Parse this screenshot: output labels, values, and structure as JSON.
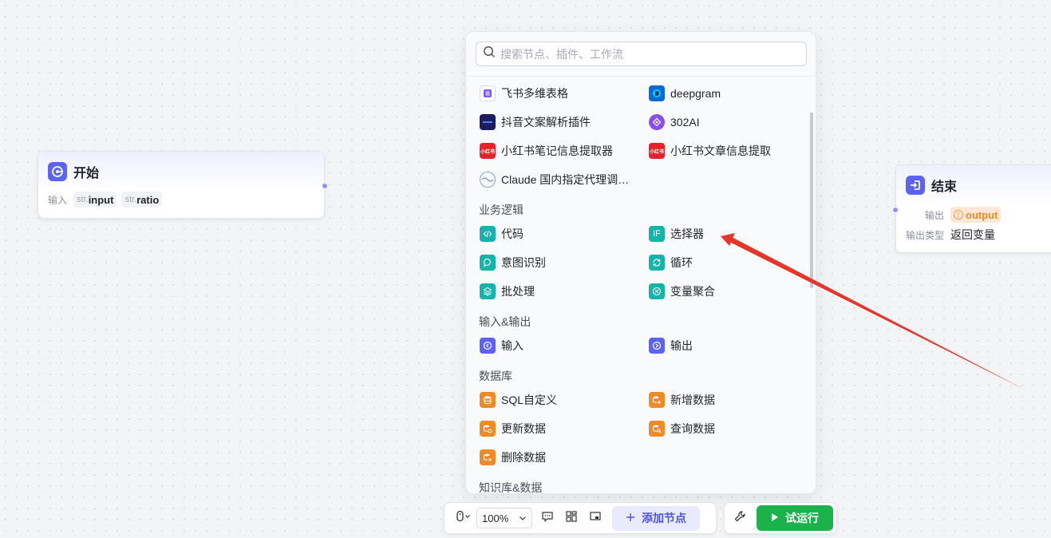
{
  "start_node": {
    "title": "开始",
    "input_label": "输入",
    "params": [
      {
        "type": "str.",
        "name": "input"
      },
      {
        "type": "str.",
        "name": "ratio"
      }
    ]
  },
  "end_node": {
    "title": "结束",
    "output_label": "输出",
    "output_var": "output",
    "output_type_label": "输出类型",
    "output_type_value": "返回变量"
  },
  "panel": {
    "search_placeholder": "搜索节点、插件、工作流",
    "plugins": [
      {
        "label": "飞书多维表格",
        "icon": "feishu-bitable-icon"
      },
      {
        "label": "deepgram",
        "icon": "deepgram-icon"
      },
      {
        "label": "抖音文案解析插件",
        "icon": "douyin-plugin-icon"
      },
      {
        "label": "302AI",
        "icon": "302ai-icon"
      },
      {
        "label": "小红书笔记信息提取器",
        "icon": "xiaohongshu-icon",
        "badge": "小红书"
      },
      {
        "label": "小红书文章信息提取",
        "icon": "xiaohongshu-icon",
        "badge": "小红书"
      },
      {
        "label": "Claude 国内指定代理调…",
        "icon": "claude-proxy-icon"
      }
    ],
    "sections": {
      "logic": {
        "title": "业务逻辑",
        "items": [
          {
            "label": "代码",
            "icon": "code-icon"
          },
          {
            "label": "选择器",
            "icon": "if-selector-icon"
          },
          {
            "label": "意图识别",
            "icon": "intent-icon"
          },
          {
            "label": "循环",
            "icon": "loop-icon"
          },
          {
            "label": "批处理",
            "icon": "batch-icon"
          },
          {
            "label": "变量聚合",
            "icon": "variable-merge-icon"
          }
        ]
      },
      "io": {
        "title": "输入&输出",
        "items": [
          {
            "label": "输入",
            "icon": "input-icon"
          },
          {
            "label": "输出",
            "icon": "output-icon"
          }
        ]
      },
      "db": {
        "title": "数据库",
        "items": [
          {
            "label": "SQL自定义",
            "icon": "sql-custom-icon"
          },
          {
            "label": "新增数据",
            "icon": "db-add-icon"
          },
          {
            "label": "更新数据",
            "icon": "db-update-icon"
          },
          {
            "label": "查询数据",
            "icon": "db-query-icon"
          },
          {
            "label": "删除数据",
            "icon": "db-delete-icon"
          }
        ]
      },
      "kb": {
        "title": "知识库&数据"
      }
    }
  },
  "toolbar": {
    "zoom": "100%",
    "add_node_label": "添加节点",
    "run_label": "试运行"
  },
  "colors": {
    "accent": "#5c62f6",
    "teal": "#14b3ac",
    "orange": "#f08a24",
    "run_green": "#1bb24b",
    "arrow_red": "#e8352a"
  }
}
